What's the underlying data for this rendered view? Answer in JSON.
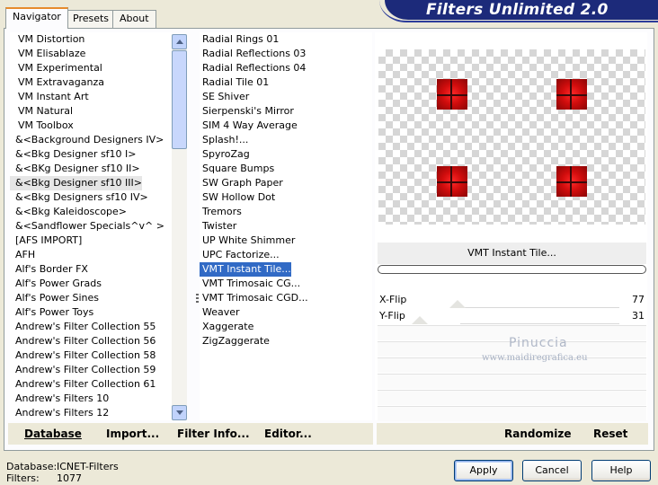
{
  "tabs": [
    {
      "label": "Navigator",
      "active": true
    },
    {
      "label": "Presets",
      "active": false
    },
    {
      "label": "About",
      "active": false
    }
  ],
  "app_title": "Filters Unlimited 2.0",
  "categories": [
    "VM Distortion",
    "VM Elisablaze",
    "VM Experimental",
    "VM Extravaganza",
    "VM Instant Art",
    "VM Natural",
    "VM Toolbox",
    "&<Background Designers IV>",
    "&<Bkg Designer sf10 I>",
    "&<BKg Designer sf10 II>",
    "&<Bkg Designer sf10 III>",
    "&<Bkg Designers sf10 IV>",
    "&<Bkg Kaleidoscope>",
    "&<Sandflower Specials^v^ >",
    "[AFS IMPORT]",
    "AFH",
    "Alf's Border FX",
    "Alf's Power Grads",
    "Alf's Power Sines",
    "Alf's Power Toys",
    "Andrew's Filter Collection 55",
    "Andrew's Filter Collection 56",
    "Andrew's Filter Collection 58",
    "Andrew's Filter Collection 59",
    "Andrew's Filter Collection 61",
    "Andrew's Filters 10",
    "Andrew's Filters 12"
  ],
  "selected_category_index": 10,
  "filters": [
    "Radial  Rings 01",
    "Radial Reflections 03",
    "Radial Reflections 04",
    "Radial Tile 01",
    "SE Shiver",
    "Sierpenski's Mirror",
    "SIM 4 Way Average",
    "Splash!...",
    "SpyroZag",
    "Square Bumps",
    "SW Graph Paper",
    "SW Hollow Dot",
    "Tremors",
    "Twister",
    "UP White Shimmer",
    "UPC Factorize...",
    "VMT Instant Tile...",
    "VMT Trimosaic CG...",
    "VMT Trimosaic CGD...",
    "Weaver",
    "Xaggerate",
    "ZigZaggerate"
  ],
  "selected_filter_index": 16,
  "current_filter_name": "VMT Instant Tile...",
  "sliders": [
    {
      "label": "X-Flip",
      "value": "77",
      "level": 77
    },
    {
      "label": "Y-Flip",
      "value": "31",
      "level": 31
    }
  ],
  "watermark": {
    "name": "Pinuccia",
    "site": "www.maidiregrafica.eu"
  },
  "left_bar": {
    "database": "Database",
    "import": "Import...",
    "filter_info": "Filter Info...",
    "editor": "Editor..."
  },
  "right_bar": {
    "randomize": "Randomize",
    "reset": "Reset"
  },
  "info": {
    "database_label": "Database:",
    "database_value": "ICNET-Filters",
    "filters_label": "Filters:",
    "filters_value": "1077"
  },
  "buttons": {
    "apply": "Apply",
    "cancel": "Cancel",
    "help": "Help"
  }
}
